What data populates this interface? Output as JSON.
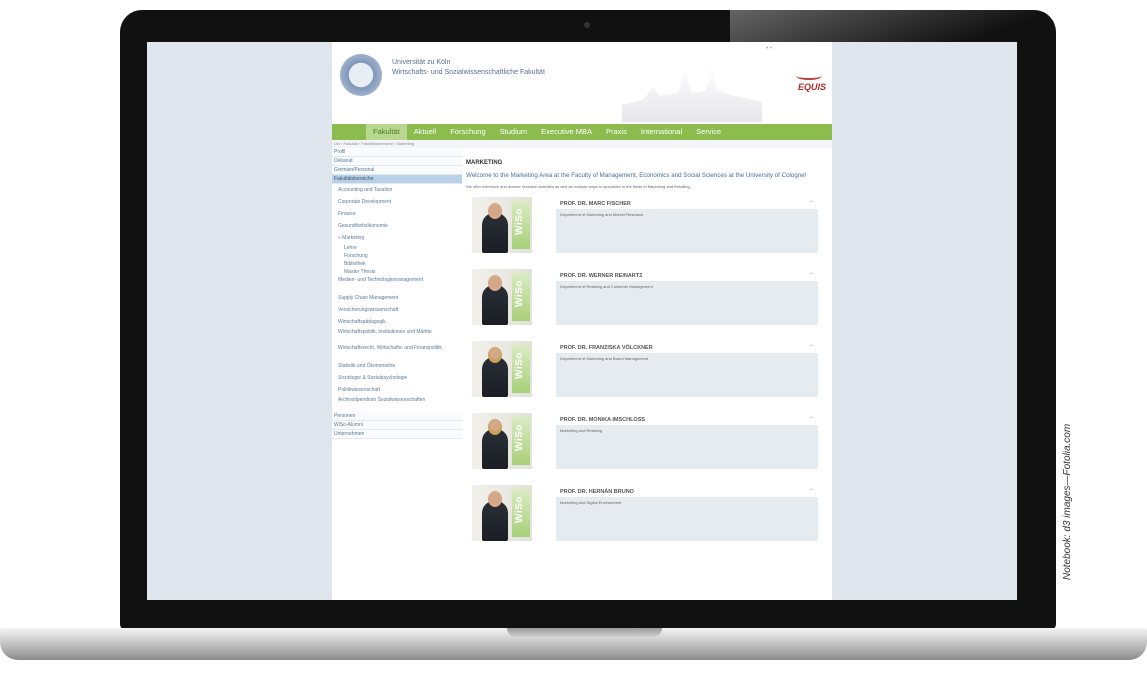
{
  "site": {
    "university": "Universität zu Köln",
    "faculty": "Wirtschafts- und Sozialwissenschaftliche Fakultät",
    "equis": "EQUIS",
    "nav": [
      "Fakultät",
      "Aktuell",
      "Forschung",
      "Studium",
      "Executive MBA",
      "Praxis",
      "International",
      "Service"
    ],
    "breadcrumb": "Uni › Fakultät › Fakultätsbereiche › Marketing",
    "sidebar": [
      {
        "label": "Profil",
        "level": 1
      },
      {
        "label": "Dekanat",
        "level": 1
      },
      {
        "label": "Gremien/Personal",
        "level": 1
      },
      {
        "label": "Fakultätsbereiche",
        "level": 1,
        "active": true
      },
      {
        "label": "Accounting and Taxation",
        "level": 2
      },
      {
        "label": "Corporate Development",
        "level": 2
      },
      {
        "label": "Finance",
        "level": 2
      },
      {
        "label": "Gesundheitsökonomie",
        "level": 2
      },
      {
        "label": "» Marketing",
        "level": 2
      },
      {
        "label": "Lehre",
        "level": 3
      },
      {
        "label": "Forschung",
        "level": 3
      },
      {
        "label": "Bibliothek",
        "level": 3
      },
      {
        "label": "Master Thesis",
        "level": 3
      },
      {
        "label": "Medien- und Technologiemanagement",
        "level": 2,
        "wrap": true
      },
      {
        "label": "Supply Chain Management",
        "level": 2
      },
      {
        "label": "Versicherungswissenschaft",
        "level": 2
      },
      {
        "label": "Wirtschaftspädagogik",
        "level": 2
      },
      {
        "label": "Wirtschaftspolitik, Institutionen und Märkte",
        "level": 2,
        "wrap": true
      },
      {
        "label": "Wirtschaftsrecht, Wirtschafts- und Finanzpolitik",
        "level": 2,
        "wrap": true
      },
      {
        "label": "Statistik und Ökonometrie",
        "level": 2
      },
      {
        "label": "Soziologie & Sozialpsychologie",
        "level": 2
      },
      {
        "label": "Politikwissenschaft",
        "level": 2
      },
      {
        "label": "Archivstipendium Sozialwissenschaften",
        "level": 2,
        "wrap": true
      },
      {
        "label": "Personen",
        "level": 1
      },
      {
        "label": "WiSo-Alumni",
        "level": 1
      },
      {
        "label": "Unternehmen",
        "level": 1
      }
    ],
    "heading": "MARKETING",
    "welcome": "Welcome to the Marketing Area at the Faculty of Management, Economics and Social Sciences at the University of Cologne!",
    "intro": "We offer extensive and diverse research activities as well as multiple ways to specialize in the fields of Marketing and Retailing.",
    "professors": [
      {
        "name": "PROF. DR. MARC FISCHER",
        "dept": "Department of Marketing and Market Research",
        "badge": "WiSo"
      },
      {
        "name": "PROF. DR. WERNER REINARTZ",
        "dept": "Department of Retailing and Customer Management",
        "badge": "WiSo"
      },
      {
        "name": "PROF. DR. FRANZISKA VÖLCKNER",
        "dept": "Department of Marketing and Brand Management",
        "badge": "WiSo"
      },
      {
        "name": "PROF. DR. MONIKA IMSCHLOSS",
        "dept": "Marketing and Retailing",
        "badge": "WiSo"
      },
      {
        "name": "PROF. DR. HERNÁN BRUNO",
        "dept": "Marketing and Digital Environment",
        "badge": "WiSo"
      }
    ],
    "arrow_glyph": "→"
  },
  "credit": "Notebook: d3 images—Fotolia.com",
  "colors": {
    "nav_green": "#8cbc4e",
    "sidebar_active": "#b9d1e6",
    "link_blue": "#4a6f94"
  }
}
